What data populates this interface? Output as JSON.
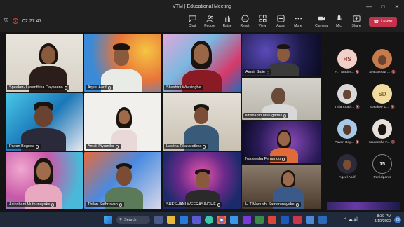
{
  "window": {
    "title": "VTM | Educational Meeting"
  },
  "toolbar": {
    "timer": "02:27:47",
    "buttons": [
      "Chat",
      "People",
      "Raise",
      "React",
      "View",
      "Apps",
      "More",
      "Camera",
      "Mic",
      "Share"
    ],
    "leave": "Leave"
  },
  "tiles": [
    {
      "name": "Speaker- Lasanthika Dayasena"
    },
    {
      "name": "Aqeel Aarif"
    },
    {
      "name": "Shashini Wijesinghe"
    },
    {
      "name": "Aamir Salie"
    },
    {
      "name": "Krishanth Murugadas"
    },
    {
      "name": "Pavan Bogoda"
    },
    {
      "name": "Amali Piyumika"
    },
    {
      "name": "Lasitha Tillakarathna"
    },
    {
      "name": "Nadeesha Fernando"
    },
    {
      "name": "Asinshani Muthunayake"
    },
    {
      "name": "Thilan Sathruwan"
    },
    {
      "name": "SHESHANI WEERASINGHE"
    },
    {
      "name": "H.T Madushi Samaranayake"
    }
  ],
  "sidebar": {
    "people": [
      {
        "initials": "HS",
        "name": "H.T Madus..."
      },
      {
        "initials": "",
        "name": "SHESHANI ..."
      },
      {
        "initials": "",
        "name": "Thilan Sath..."
      },
      {
        "initials": "SD",
        "name": "Speaker- Li..."
      },
      {
        "initials": "",
        "name": "Pavan Bog..."
      },
      {
        "initials": "",
        "name": "Nadeesha F..."
      },
      {
        "initials": "",
        "name": "Aqeel Aarif"
      }
    ],
    "participants_count": "15",
    "participants_label": "Participants"
  },
  "taskbar": {
    "search": "Search",
    "time": "8:39 PM",
    "date": "3/10/2023",
    "notif": "29"
  }
}
